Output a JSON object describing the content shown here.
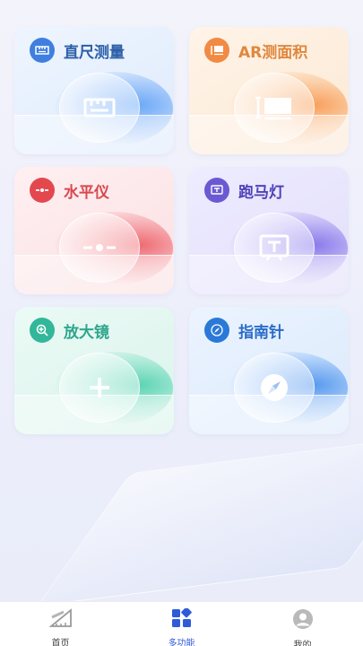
{
  "cards": [
    {
      "title": "直尺测量",
      "icon": "ruler-icon",
      "color": "#2d6fd6",
      "title_color": "#2b5fa8"
    },
    {
      "title": "AR测面积",
      "icon": "ar-area-icon",
      "color": "#f0883c",
      "title_color": "#e0873d"
    },
    {
      "title": "水平仪",
      "icon": "level-icon",
      "color": "#e2474e",
      "title_color": "#d8484f"
    },
    {
      "title": "跑马灯",
      "icon": "marquee-icon",
      "color": "#6b59d3",
      "title_color": "#4f43b8"
    },
    {
      "title": "放大镜",
      "icon": "magnifier-icon",
      "color": "#32b79a",
      "title_color": "#2ea68d"
    },
    {
      "title": "指南针",
      "icon": "compass-icon",
      "color": "#2a79d8",
      "title_color": "#2a6cc8"
    }
  ],
  "tabbar": {
    "active_color": "#2f5bd8",
    "items": [
      {
        "label": "首页",
        "icon": "home-ruler-icon"
      },
      {
        "label": "多功能",
        "icon": "grid-icon"
      },
      {
        "label": "我的",
        "icon": "profile-icon"
      }
    ]
  }
}
